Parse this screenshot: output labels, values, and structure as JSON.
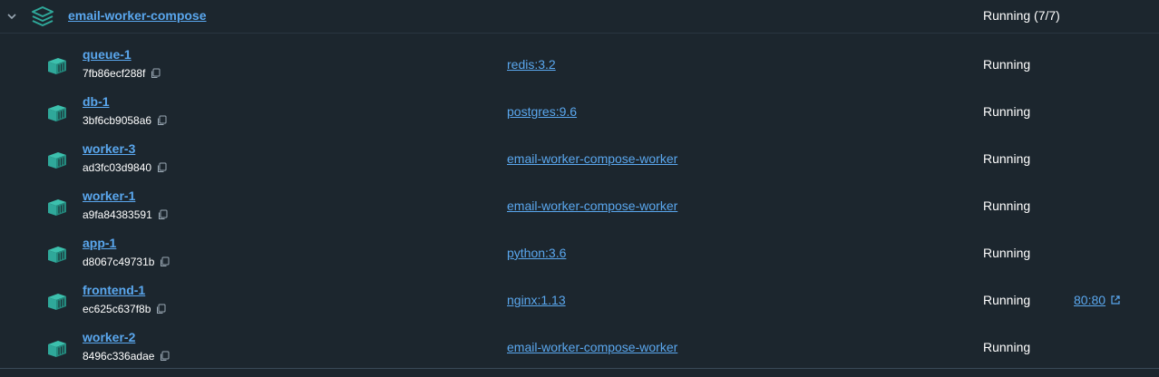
{
  "group": {
    "name": "email-worker-compose",
    "status": "Running (7/7)",
    "icon": "stack-icon",
    "expand_icon": "chevron-down-icon"
  },
  "colors": {
    "background": "#1c262e",
    "link": "#5aa7ee",
    "container_icon": "#2fa89a",
    "text": "#ffffff"
  },
  "containers": [
    {
      "name": "queue-1",
      "id": "7fb86ecf288f",
      "image": "redis:3.2",
      "status": "Running",
      "port": ""
    },
    {
      "name": "db-1",
      "id": "3bf6cb9058a6",
      "image": "postgres:9.6",
      "status": "Running",
      "port": ""
    },
    {
      "name": "worker-3",
      "id": "ad3fc03d9840",
      "image": "email-worker-compose-worker",
      "status": "Running",
      "port": ""
    },
    {
      "name": "worker-1",
      "id": "a9fa84383591",
      "image": "email-worker-compose-worker",
      "status": "Running",
      "port": ""
    },
    {
      "name": "app-1",
      "id": "d8067c49731b",
      "image": "python:3.6",
      "status": "Running",
      "port": ""
    },
    {
      "name": "frontend-1",
      "id": "ec625c637f8b",
      "image": "nginx:1.13",
      "status": "Running",
      "port": "80:80"
    },
    {
      "name": "worker-2",
      "id": "8496c336adae",
      "image": "email-worker-compose-worker",
      "status": "Running",
      "port": ""
    }
  ]
}
